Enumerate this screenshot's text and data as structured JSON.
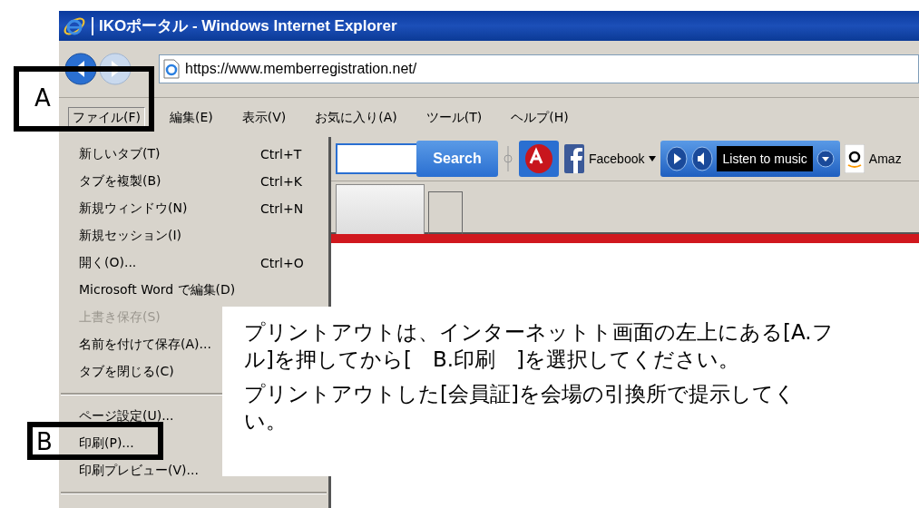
{
  "window": {
    "title": "IKOポータル - Windows Internet Explorer"
  },
  "address_bar": {
    "url": "https://www.memberregistration.net/"
  },
  "menu_bar": [
    {
      "label": "ファイル(F)",
      "selected": true
    },
    {
      "label": "編集(E)",
      "selected": false
    },
    {
      "label": "表示(V)",
      "selected": false
    },
    {
      "label": "お気に入り(A)",
      "selected": false
    },
    {
      "label": "ツール(T)",
      "selected": false
    },
    {
      "label": "ヘルプ(H)",
      "selected": false
    }
  ],
  "toolbar": {
    "search_button": "Search",
    "facebook": "Facebook",
    "music": "Listen to music",
    "amazon": "Amaz"
  },
  "file_menu": [
    {
      "kind": "item",
      "label": "新しいタブ(T)",
      "shortcut": "Ctrl+T",
      "disabled": false
    },
    {
      "kind": "item",
      "label": "タブを複製(B)",
      "shortcut": "Ctrl+K",
      "disabled": false
    },
    {
      "kind": "item",
      "label": "新規ウィンドウ(N)",
      "shortcut": "Ctrl+N",
      "disabled": false
    },
    {
      "kind": "item",
      "label": "新規セッション(I)",
      "disabled": false
    },
    {
      "kind": "item",
      "label": "開く(O)...",
      "shortcut": "Ctrl+O",
      "disabled": false
    },
    {
      "kind": "item",
      "label": "Microsoft Word で編集(D)",
      "disabled": false
    },
    {
      "kind": "item",
      "label": "上書き保存(S)",
      "disabled": true
    },
    {
      "kind": "item",
      "label": "名前を付けて保存(A)...",
      "disabled": false
    },
    {
      "kind": "item",
      "label": "タブを閉じる(C)",
      "disabled": false
    },
    {
      "kind": "separator"
    },
    {
      "kind": "item",
      "label": "ページ設定(U)...",
      "disabled": false
    },
    {
      "kind": "item",
      "label": "印刷(P)...",
      "disabled": false
    },
    {
      "kind": "item",
      "label": "印刷プレビュー(V)...",
      "disabled": false
    },
    {
      "kind": "separator"
    }
  ],
  "annotations": [
    {
      "label": "A"
    },
    {
      "label": "B"
    }
  ],
  "note": {
    "paragraphs": [
      [
        "プリントアウトは、インターネットト画面の左上にある[A.フ",
        "ル]を押してから[　B.印刷　]を選択してください。"
      ],
      [
        "プリントアウトした[会員証]を会場の引換所で提示してく",
        "い。"
      ]
    ]
  }
}
